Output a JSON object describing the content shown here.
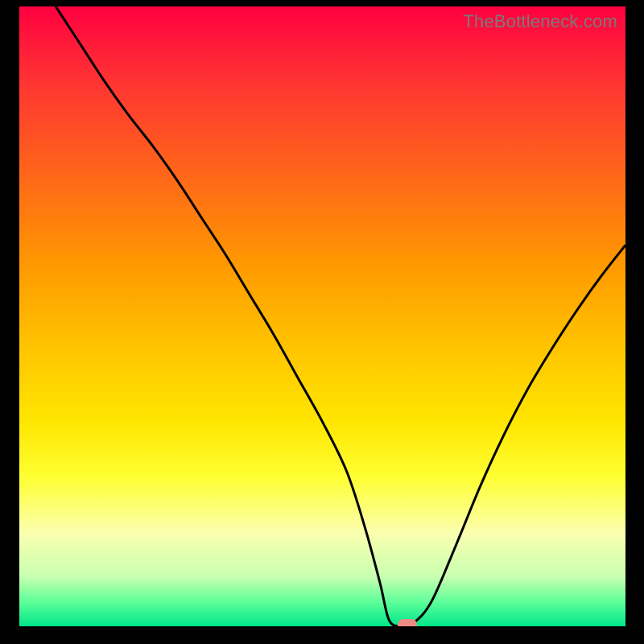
{
  "watermark": "TheBottleneck.com",
  "colors": {
    "curve": "#000000",
    "marker": "#ed8a84",
    "frame": "#000000"
  },
  "chart_data": {
    "type": "line",
    "title": "",
    "xlabel": "",
    "ylabel": "",
    "xlim": [
      0,
      100
    ],
    "ylim": [
      0,
      100
    ],
    "grid": false,
    "legend": false,
    "annotations": [
      "TheBottleneck.com"
    ],
    "background_gradient_note": "vertical rainbow red→green indicating goodness (green bottom = best)",
    "series": [
      {
        "name": "curve",
        "x": [
          6,
          10,
          14,
          18,
          22,
          26,
          30,
          34,
          38,
          42,
          46,
          50,
          54,
          57,
          59.5,
          61,
          63,
          65,
          68,
          72,
          76,
          80,
          84,
          88,
          92,
          96,
          100
        ],
        "y": [
          100,
          94,
          88,
          82.5,
          77.5,
          72,
          66,
          60,
          53.5,
          47,
          40,
          33,
          25,
          16,
          7,
          1,
          0,
          0.5,
          4,
          13,
          22.5,
          31,
          38.5,
          45,
          51,
          56.5,
          61.5
        ]
      }
    ],
    "marker": {
      "x": 64,
      "y": 0.2
    }
  }
}
